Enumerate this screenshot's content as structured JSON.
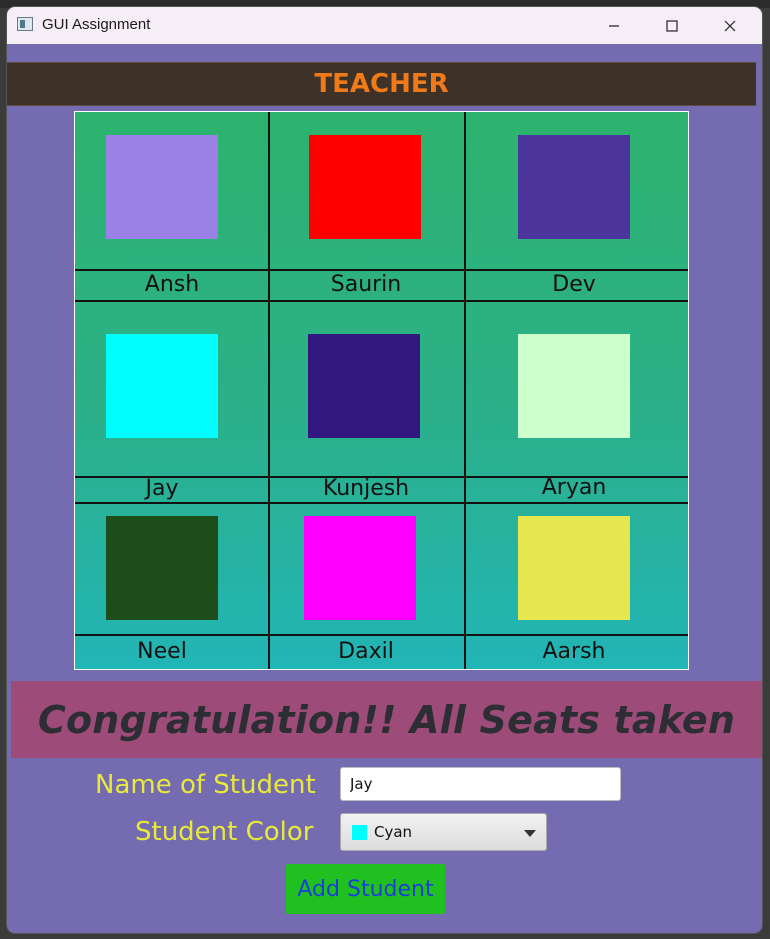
{
  "window": {
    "title": "GUI Assignment",
    "controls": [
      "minimize",
      "maximize",
      "close"
    ]
  },
  "header": {
    "teacher_label": "TEACHER"
  },
  "seats": [
    {
      "name": "Ansh",
      "color": "#9b81e5"
    },
    {
      "name": "Saurin",
      "color": "#ff0000"
    },
    {
      "name": "Dev",
      "color": "#4b349b"
    },
    {
      "name": "Jay",
      "color": "#00ffff"
    },
    {
      "name": "Kunjesh",
      "color": "#32187e"
    },
    {
      "name": "Aryan",
      "color": "#ccffcc"
    },
    {
      "name": "Neel",
      "color": "#1d4e19"
    },
    {
      "name": "Daxil",
      "color": "#ff00ff"
    },
    {
      "name": "Aarsh",
      "color": "#e6e64e"
    }
  ],
  "status": {
    "message": "Congratulation!! All Seats taken"
  },
  "form": {
    "name_label": "Name of Student",
    "name_value": "Jay",
    "color_label": "Student Color",
    "color_selected": "Cyan",
    "color_selected_hex": "#00ffff",
    "add_button": "Add Student"
  },
  "colors": {
    "window_bg": "#756bb0",
    "header_bg": "#3d3128",
    "header_text": "#f07a1a",
    "grid_gradient_top": "#2db36e",
    "grid_gradient_bottom": "#22b5b6",
    "status_bg": "#9d4b78",
    "label_text": "#e8ea3a",
    "button_bg": "#1fc01f",
    "button_text": "#1c3fd6"
  }
}
